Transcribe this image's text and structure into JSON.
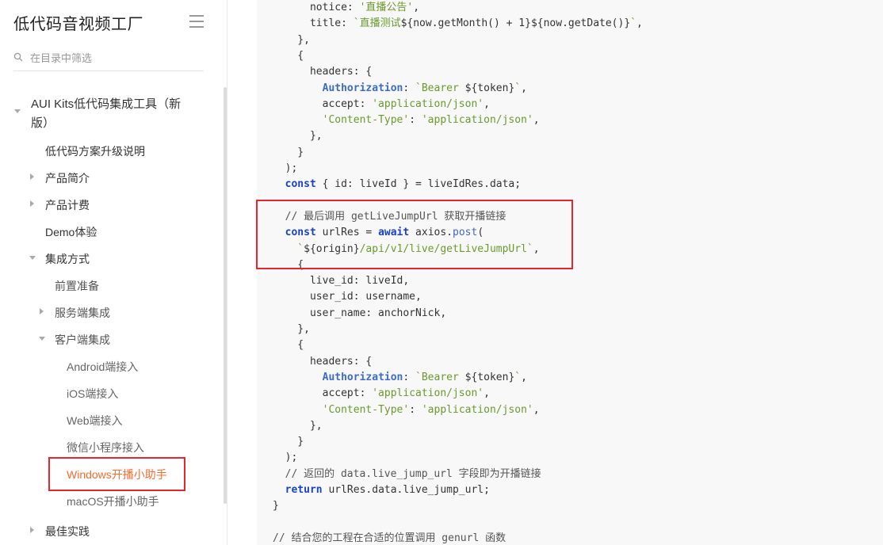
{
  "sidebar": {
    "title": "低代码音视频工厂",
    "filter_placeholder": "在目录中筛选",
    "items": [
      {
        "label": "AUI Kits低代码集成工具（新",
        "label2": "版）",
        "level": 1,
        "expanded": true
      },
      {
        "label": "低代码方案升级说明",
        "level": 2
      },
      {
        "label": "产品简介",
        "level": 2,
        "expanded": false
      },
      {
        "label": "产品计费",
        "level": 2,
        "expanded": false
      },
      {
        "label": "Demo体验",
        "level": 2
      },
      {
        "label": "集成方式",
        "level": 2,
        "expanded": true
      },
      {
        "label": "前置准备",
        "level": 3
      },
      {
        "label": "服务端集成",
        "level": 3,
        "expanded": false
      },
      {
        "label": "客户端集成",
        "level": 3,
        "expanded": true
      },
      {
        "label": "Android端接入",
        "level": 4
      },
      {
        "label": "iOS端接入",
        "level": 4
      },
      {
        "label": "Web端接入",
        "level": 4
      },
      {
        "label": "微信小程序接入",
        "level": 4
      },
      {
        "label": "Windows开播小助手",
        "level": 4,
        "active": true
      },
      {
        "label": "macOS开播小助手",
        "level": 4
      },
      {
        "label": "最佳实践",
        "level": 2,
        "expanded": false
      }
    ]
  },
  "colors": {
    "active_item": "#f56c2d",
    "highlight_box": "#e5262f",
    "keyword": "#1a41c6",
    "string": "#6b9a2e",
    "code_background": "#f8f8f8"
  },
  "code": {
    "lines": [
      [
        {
          "t": "      notice: "
        },
        {
          "t": "'直播公告'",
          "c": "str"
        },
        {
          "t": ","
        }
      ],
      [
        {
          "t": "      title: "
        },
        {
          "t": "`直播测试",
          "c": "str"
        },
        {
          "t": "${now.getMonth() + 1}${now.getDate()}"
        },
        {
          "t": "`",
          "c": "str"
        },
        {
          "t": ","
        }
      ],
      [
        {
          "t": "    },"
        }
      ],
      [
        {
          "t": "    {"
        }
      ],
      [
        {
          "t": "      headers: {"
        }
      ],
      [
        {
          "t": "        "
        },
        {
          "t": "Authorization",
          "c": "prop"
        },
        {
          "t": ": "
        },
        {
          "t": "`Bearer ",
          "c": "str"
        },
        {
          "t": "${token}"
        },
        {
          "t": "`",
          "c": "str"
        },
        {
          "t": ","
        }
      ],
      [
        {
          "t": "        accept: "
        },
        {
          "t": "'application/json'",
          "c": "str"
        },
        {
          "t": ","
        }
      ],
      [
        {
          "t": "        "
        },
        {
          "t": "'Content-Type'",
          "c": "str"
        },
        {
          "t": ": "
        },
        {
          "t": "'application/json'",
          "c": "str"
        },
        {
          "t": ","
        }
      ],
      [
        {
          "t": "      },"
        }
      ],
      [
        {
          "t": "    }"
        }
      ],
      [
        {
          "t": "  );"
        }
      ],
      [
        {
          "t": "  "
        },
        {
          "t": "const",
          "c": "kw"
        },
        {
          "t": " { id: liveId } = liveIdRes.data;"
        }
      ],
      [
        {
          "t": ""
        }
      ],
      [
        {
          "t": "  // 最后调用 getLiveJumpUrl 获取开播链接",
          "c": "cm"
        }
      ],
      [
        {
          "t": "  "
        },
        {
          "t": "const",
          "c": "kw"
        },
        {
          "t": " urlRes = "
        },
        {
          "t": "await",
          "c": "kw"
        },
        {
          "t": " axios."
        },
        {
          "t": "post",
          "c": "fn"
        },
        {
          "t": "("
        }
      ],
      [
        {
          "t": "    `",
          "c": "str"
        },
        {
          "t": "${origin}"
        },
        {
          "t": "/api/v1/live/getLiveJumpUrl`",
          "c": "str"
        },
        {
          "t": ","
        }
      ],
      [
        {
          "t": "    {"
        }
      ],
      [
        {
          "t": "      live_id: liveId,"
        }
      ],
      [
        {
          "t": "      user_id: username,"
        }
      ],
      [
        {
          "t": "      user_name: anchorNick,"
        }
      ],
      [
        {
          "t": "    },"
        }
      ],
      [
        {
          "t": "    {"
        }
      ],
      [
        {
          "t": "      headers: {"
        }
      ],
      [
        {
          "t": "        "
        },
        {
          "t": "Authorization",
          "c": "prop"
        },
        {
          "t": ": "
        },
        {
          "t": "`Bearer ",
          "c": "str"
        },
        {
          "t": "${token}"
        },
        {
          "t": "`",
          "c": "str"
        },
        {
          "t": ","
        }
      ],
      [
        {
          "t": "        accept: "
        },
        {
          "t": "'application/json'",
          "c": "str"
        },
        {
          "t": ","
        }
      ],
      [
        {
          "t": "        "
        },
        {
          "t": "'Content-Type'",
          "c": "str"
        },
        {
          "t": ": "
        },
        {
          "t": "'application/json'",
          "c": "str"
        },
        {
          "t": ","
        }
      ],
      [
        {
          "t": "      },"
        }
      ],
      [
        {
          "t": "    }"
        }
      ],
      [
        {
          "t": "  );"
        }
      ],
      [
        {
          "t": "  // 返回的 data.live_jump_url 字段即为开播链接",
          "c": "cm"
        }
      ],
      [
        {
          "t": "  "
        },
        {
          "t": "return",
          "c": "kw"
        },
        {
          "t": " urlRes.data.live_jump_url;"
        }
      ],
      [
        {
          "t": "}"
        }
      ],
      [
        {
          "t": ""
        }
      ],
      [
        {
          "t": "// 结合您的工程在合适的位置调用 genurl 函数",
          "c": "cm"
        }
      ]
    ]
  }
}
